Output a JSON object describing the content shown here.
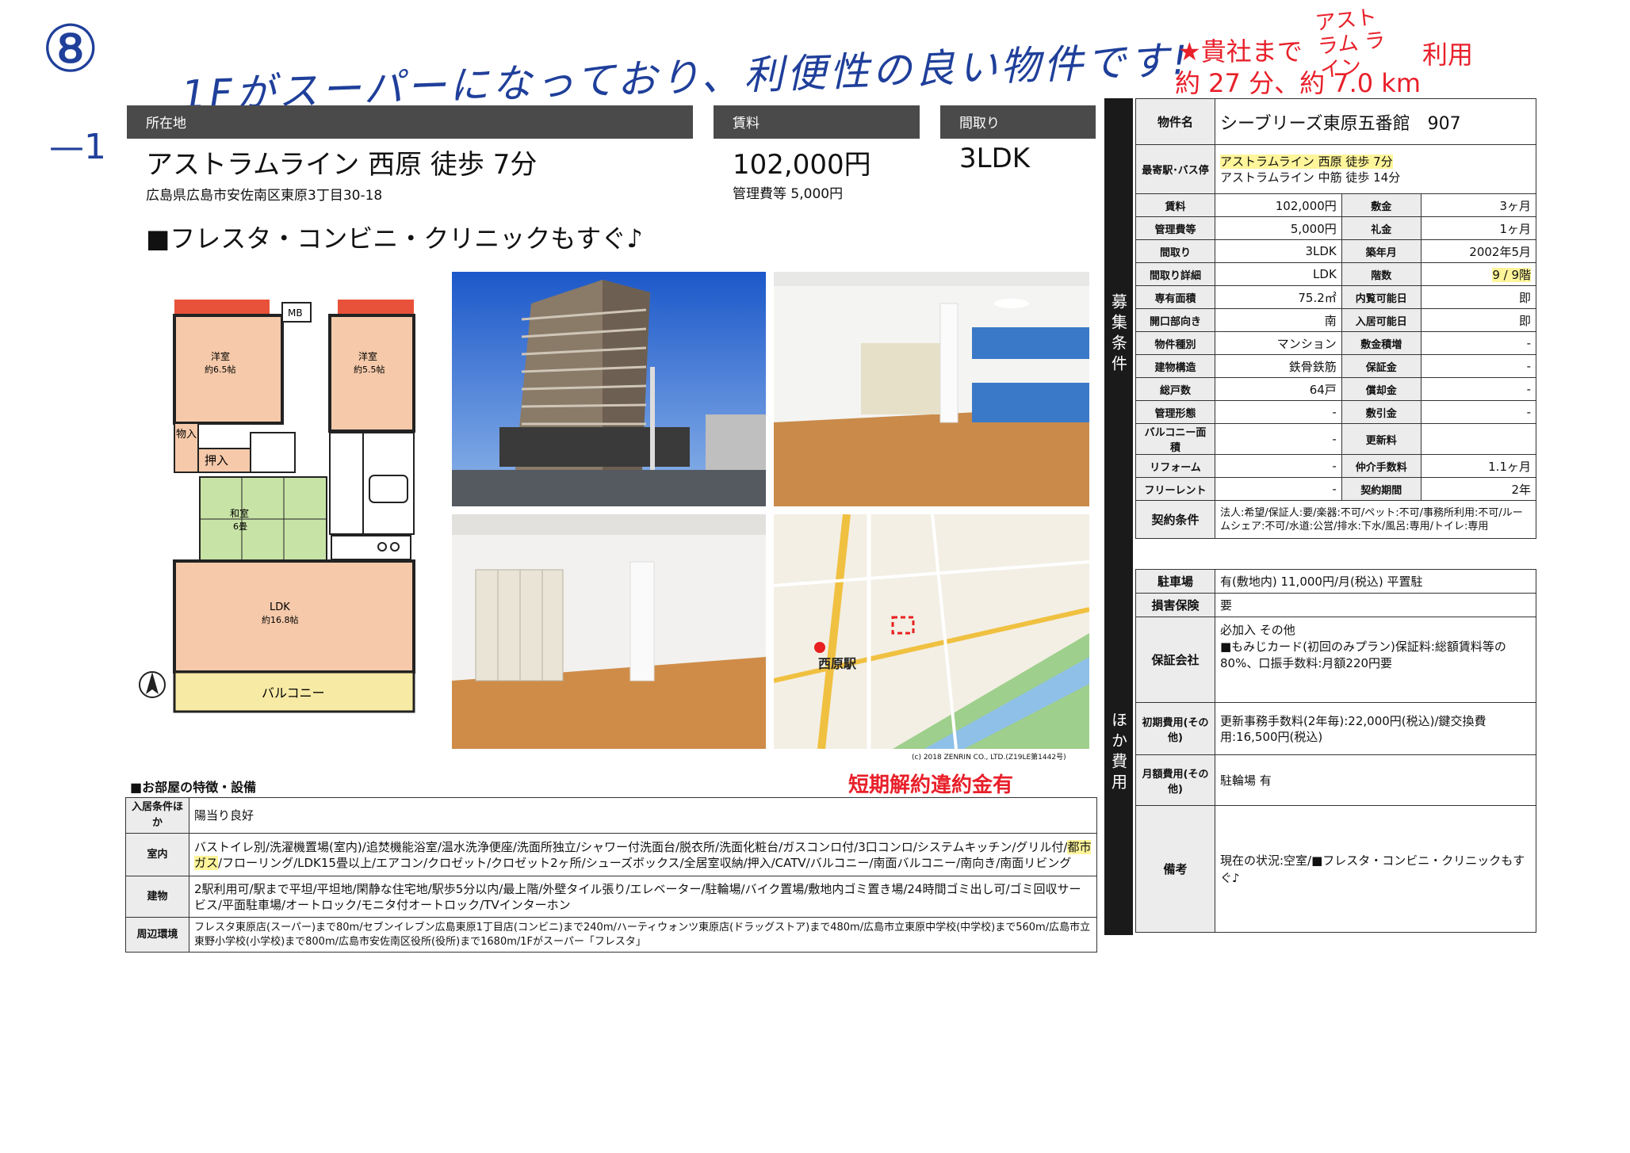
{
  "handwriting": {
    "circle_num": "⑧",
    "dash_num": "—1",
    "note": "1Fがスーパーになっており、利便性の良い物件です!",
    "access_line1": "★貴社まで",
    "access_line_small": "アストラム ライン",
    "access_use": "利用",
    "access_line2": "約 27 分、約 7.0 km"
  },
  "headers": {
    "location": "所在地",
    "rent": "賃料",
    "layout": "間取り"
  },
  "summary": {
    "station": "アストラムライン 西原 徒歩 7分",
    "address": "広島県広島市安佐南区東原3丁目30-18",
    "rent": "102,000円",
    "mgmt_fee": "管理費等 5,000円",
    "layout": "3LDK",
    "catch": "■フレスタ・コンビニ・クリニックもすぐ♪"
  },
  "floorplan": {
    "room1": "洋室",
    "room1_size": "約6.5帖",
    "room2": "洋室",
    "room2_size": "約5.5帖",
    "storage": "物入",
    "closet": "押入",
    "washitsu": "和室",
    "washitsu_size": "6畳",
    "ldk": "LDK",
    "ldk_size": "約16.8帖",
    "balcony": "バルコニー",
    "mb": "MB"
  },
  "map": {
    "station_label": "西原駅",
    "copyright": "(c) 2018 ZENRIN CO., LTD.(Z19LE第1442号)"
  },
  "spec": {
    "name_label": "物件名",
    "name": "シーブリーズ東原五番館　907",
    "station_label": "最寄駅･バス停",
    "station1": "アストラムライン 西原 徒歩 7分",
    "station2": "アストラムライン 中筋 徒歩 14分",
    "side_recruit": "募集条件",
    "side_other": "ほか費用",
    "rows": [
      {
        "l1": "賃料",
        "v1": "102,000円",
        "l2": "敷金",
        "v2": "3ヶ月"
      },
      {
        "l1": "管理費等",
        "v1": "5,000円",
        "l2": "礼金",
        "v2": "1ヶ月"
      },
      {
        "l1": "間取り",
        "v1": "3LDK",
        "l2": "築年月",
        "v2": "2002年5月"
      },
      {
        "l1": "間取り詳細",
        "v1": "LDK",
        "l2": "階数",
        "v2": "9 / 9階"
      },
      {
        "l1": "専有面積",
        "v1": "75.2㎡",
        "l2": "内覧可能日",
        "v2": "即"
      },
      {
        "l1": "開口部向き",
        "v1": "南",
        "l2": "入居可能日",
        "v2": "即"
      },
      {
        "l1": "物件種別",
        "v1": "マンション",
        "l2": "敷金積増",
        "v2": "-"
      },
      {
        "l1": "建物構造",
        "v1": "鉄骨鉄筋",
        "l2": "保証金",
        "v2": "-"
      },
      {
        "l1": "総戸数",
        "v1": "64戸",
        "l2": "償却金",
        "v2": "-"
      },
      {
        "l1": "管理形態",
        "v1": "-",
        "l2": "敷引金",
        "v2": "-"
      },
      {
        "l1": "バルコニー面積",
        "v1": "-",
        "l2": "更新料",
        "v2": ""
      },
      {
        "l1": "リフォーム",
        "v1": "-",
        "l2": "仲介手数料",
        "v2": "1.1ヶ月"
      },
      {
        "l1": "フリーレント",
        "v1": "-",
        "l2": "契約期間",
        "v2": "2年"
      }
    ],
    "contract_label": "契約条件",
    "contract": "法人:希望/保証人:要/楽器:不可/ペット:不可/事務所利用:不可/ルームシェア:不可/水道:公営/排水:下水/風呂:専用/トイレ:専用",
    "parking_label": "駐車場",
    "parking": "有(敷地内) 11,000円/月(税込) 平置駐",
    "insurance_label": "損害保険",
    "insurance": "要",
    "guarantor_label": "保証会社",
    "guarantor": "必加入 その他\n■もみじカード(初回のみプラン)保証料:総額賃料等の80%、口振手数料:月額220円要",
    "initial_label": "初期費用(その他)",
    "initial": "更新事務手数料(2年毎):22,000円(税込)/鍵交換費用:16,500円(税込)",
    "monthly_label": "月額費用(その他)",
    "monthly": "駐輪場 有",
    "remarks_label": "備考",
    "remarks": "現在の状況:空室/■フレスタ・コンビニ・クリニックもすぐ♪"
  },
  "features": {
    "title": "■お部屋の特徴・設備",
    "short_term": "短期解約違約金有",
    "rows": [
      {
        "label": "入居条件ほか",
        "text": "陽当り良好"
      },
      {
        "label": "室内",
        "text_a": "バストイレ別/洗濯機置場(室内)/追焚機能浴室/温水洗浄便座/洗面所独立/シャワー付洗面台/脱衣所/洗面化粧台/ガスコンロ付/3口コンロ/システムキッチン/グリル付/",
        "text_hl1": "都市",
        "text_hl2": "ガス",
        "text_b": "/フローリング/LDK15畳以上/エアコン/クロゼット/クロゼット2ヶ所/シューズボックス/全居室収納/押入/CATV/バルコニー/南面バルコニー/南向き/南面リビング"
      },
      {
        "label": "建物",
        "text": "2駅利用可/駅まで平坦/平坦地/閑静な住宅地/駅歩5分以内/最上階/外壁タイル張り/エレベーター/駐輪場/バイク置場/敷地内ゴミ置き場/24時間ゴミ出し可/ゴミ回収サービス/平面駐車場/オートロック/モニタ付オートロック/TVインターホン"
      },
      {
        "label": "周辺環境",
        "text": "フレスタ東原店(スーパー)まで80m/セブンイレブン広島東原1丁目店(コンビニ)まで240m/ハーティウォンツ東原店(ドラッグストア)まで480m/広島市立東原中学校(中学校)まで560m/広島市立東野小学校(小学校)まで800m/広島市安佐南区役所(役所)まで1680m/1Fがスーパー「フレスタ」"
      }
    ]
  }
}
